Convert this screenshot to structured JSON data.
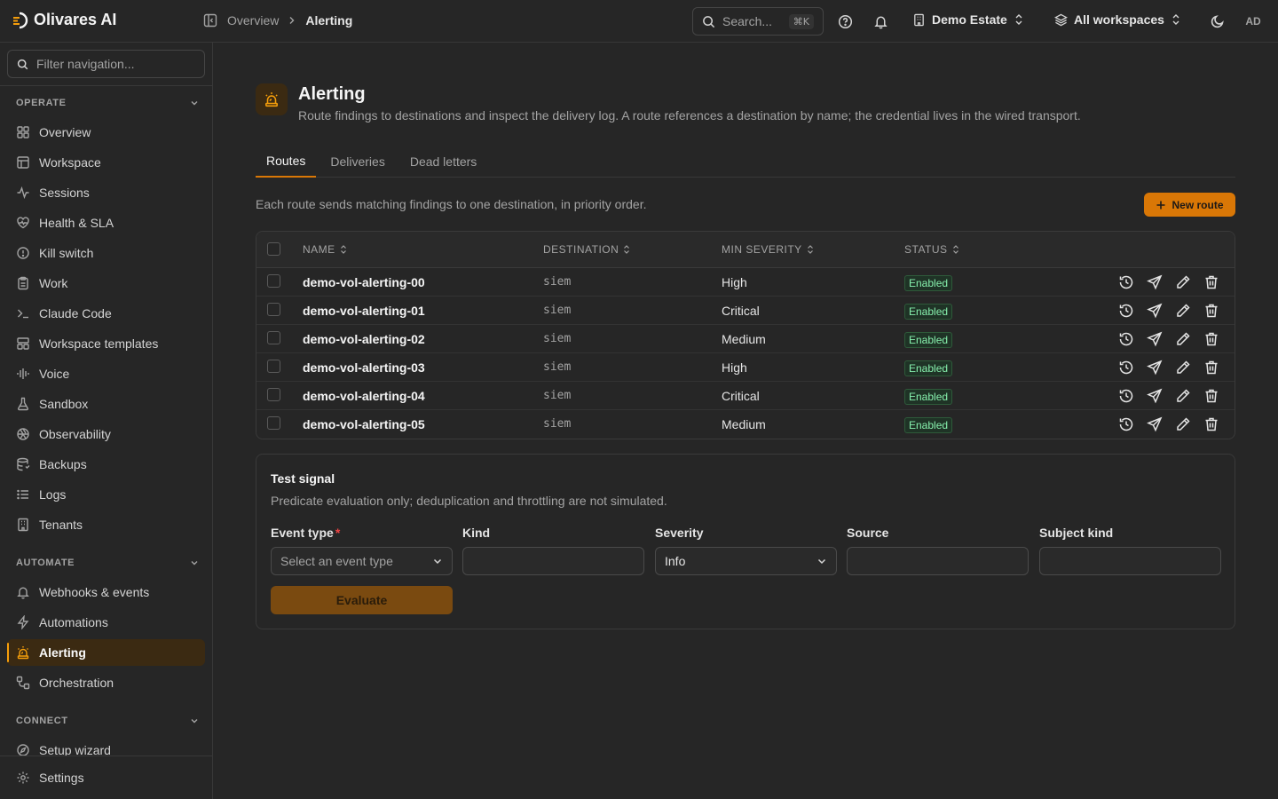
{
  "app": {
    "name": "Olivares AI"
  },
  "breadcrumb": [
    "Overview",
    "Alerting"
  ],
  "topbar": {
    "search_placeholder": "Search...",
    "search_shortcut": "⌘K",
    "org_selector": "Demo Estate",
    "workspace_selector": "All workspaces",
    "avatar_initials": "AD"
  },
  "sidebar": {
    "filter_placeholder": "Filter navigation...",
    "sections": [
      {
        "title": "OPERATE",
        "items": [
          {
            "label": "Overview",
            "icon": "grid-icon"
          },
          {
            "label": "Workspace",
            "icon": "layout-icon"
          },
          {
            "label": "Sessions",
            "icon": "activity-icon"
          },
          {
            "label": "Health & SLA",
            "icon": "heart-pulse-icon"
          },
          {
            "label": "Kill switch",
            "icon": "alert-circle-icon"
          },
          {
            "label": "Work",
            "icon": "clipboard-icon"
          },
          {
            "label": "Claude Code",
            "icon": "terminal-icon"
          },
          {
            "label": "Workspace templates",
            "icon": "template-icon"
          },
          {
            "label": "Voice",
            "icon": "audio-waveform-icon"
          },
          {
            "label": "Sandbox",
            "icon": "flask-icon"
          },
          {
            "label": "Observability",
            "icon": "aperture-icon"
          },
          {
            "label": "Backups",
            "icon": "database-backup-icon"
          },
          {
            "label": "Logs",
            "icon": "list-icon"
          },
          {
            "label": "Tenants",
            "icon": "building-icon"
          }
        ]
      },
      {
        "title": "AUTOMATE",
        "items": [
          {
            "label": "Webhooks & events",
            "icon": "bell-icon"
          },
          {
            "label": "Automations",
            "icon": "zap-icon"
          },
          {
            "label": "Alerting",
            "icon": "siren-icon",
            "active": true
          },
          {
            "label": "Orchestration",
            "icon": "workflow-icon"
          }
        ]
      },
      {
        "title": "CONNECT",
        "items": [
          {
            "label": "Setup wizard",
            "icon": "compass-icon"
          }
        ]
      }
    ],
    "footer": {
      "label": "Settings",
      "icon": "gear-icon"
    }
  },
  "page": {
    "title": "Alerting",
    "subtitle": "Route findings to destinations and inspect the delivery log. A route references a destination by name; the credential lives in the wired transport.",
    "tabs": [
      {
        "label": "Routes",
        "active": true
      },
      {
        "label": "Deliveries"
      },
      {
        "label": "Dead letters"
      }
    ],
    "routes_description": "Each route sends matching findings to one destination, in priority order.",
    "new_route_label": "New route"
  },
  "routes_table": {
    "columns": [
      "NAME",
      "DESTINATION",
      "MIN SEVERITY",
      "STATUS"
    ],
    "rows": [
      {
        "name": "demo-vol-alerting-00",
        "destination": "siem",
        "min_severity": "High",
        "status": "Enabled"
      },
      {
        "name": "demo-vol-alerting-01",
        "destination": "siem",
        "min_severity": "Critical",
        "status": "Enabled"
      },
      {
        "name": "demo-vol-alerting-02",
        "destination": "siem",
        "min_severity": "Medium",
        "status": "Enabled"
      },
      {
        "name": "demo-vol-alerting-03",
        "destination": "siem",
        "min_severity": "High",
        "status": "Enabled"
      },
      {
        "name": "demo-vol-alerting-04",
        "destination": "siem",
        "min_severity": "Critical",
        "status": "Enabled"
      },
      {
        "name": "demo-vol-alerting-05",
        "destination": "siem",
        "min_severity": "Medium",
        "status": "Enabled"
      }
    ],
    "row_actions": [
      "history-icon",
      "send-icon",
      "pencil-icon",
      "trash-icon"
    ]
  },
  "test_signal": {
    "title": "Test signal",
    "subtitle": "Predicate evaluation only; deduplication and throttling are not simulated.",
    "fields": {
      "event_type": {
        "label": "Event type",
        "required": true,
        "placeholder": "Select an event type"
      },
      "kind": {
        "label": "Kind",
        "value": ""
      },
      "severity": {
        "label": "Severity",
        "value": "Info"
      },
      "source": {
        "label": "Source",
        "value": ""
      },
      "subject_kind": {
        "label": "Subject kind",
        "value": ""
      }
    },
    "evaluate_label": "Evaluate"
  },
  "colors": {
    "accent": "#d97706",
    "enabled_badge": "#86efac",
    "background": "#262626"
  }
}
